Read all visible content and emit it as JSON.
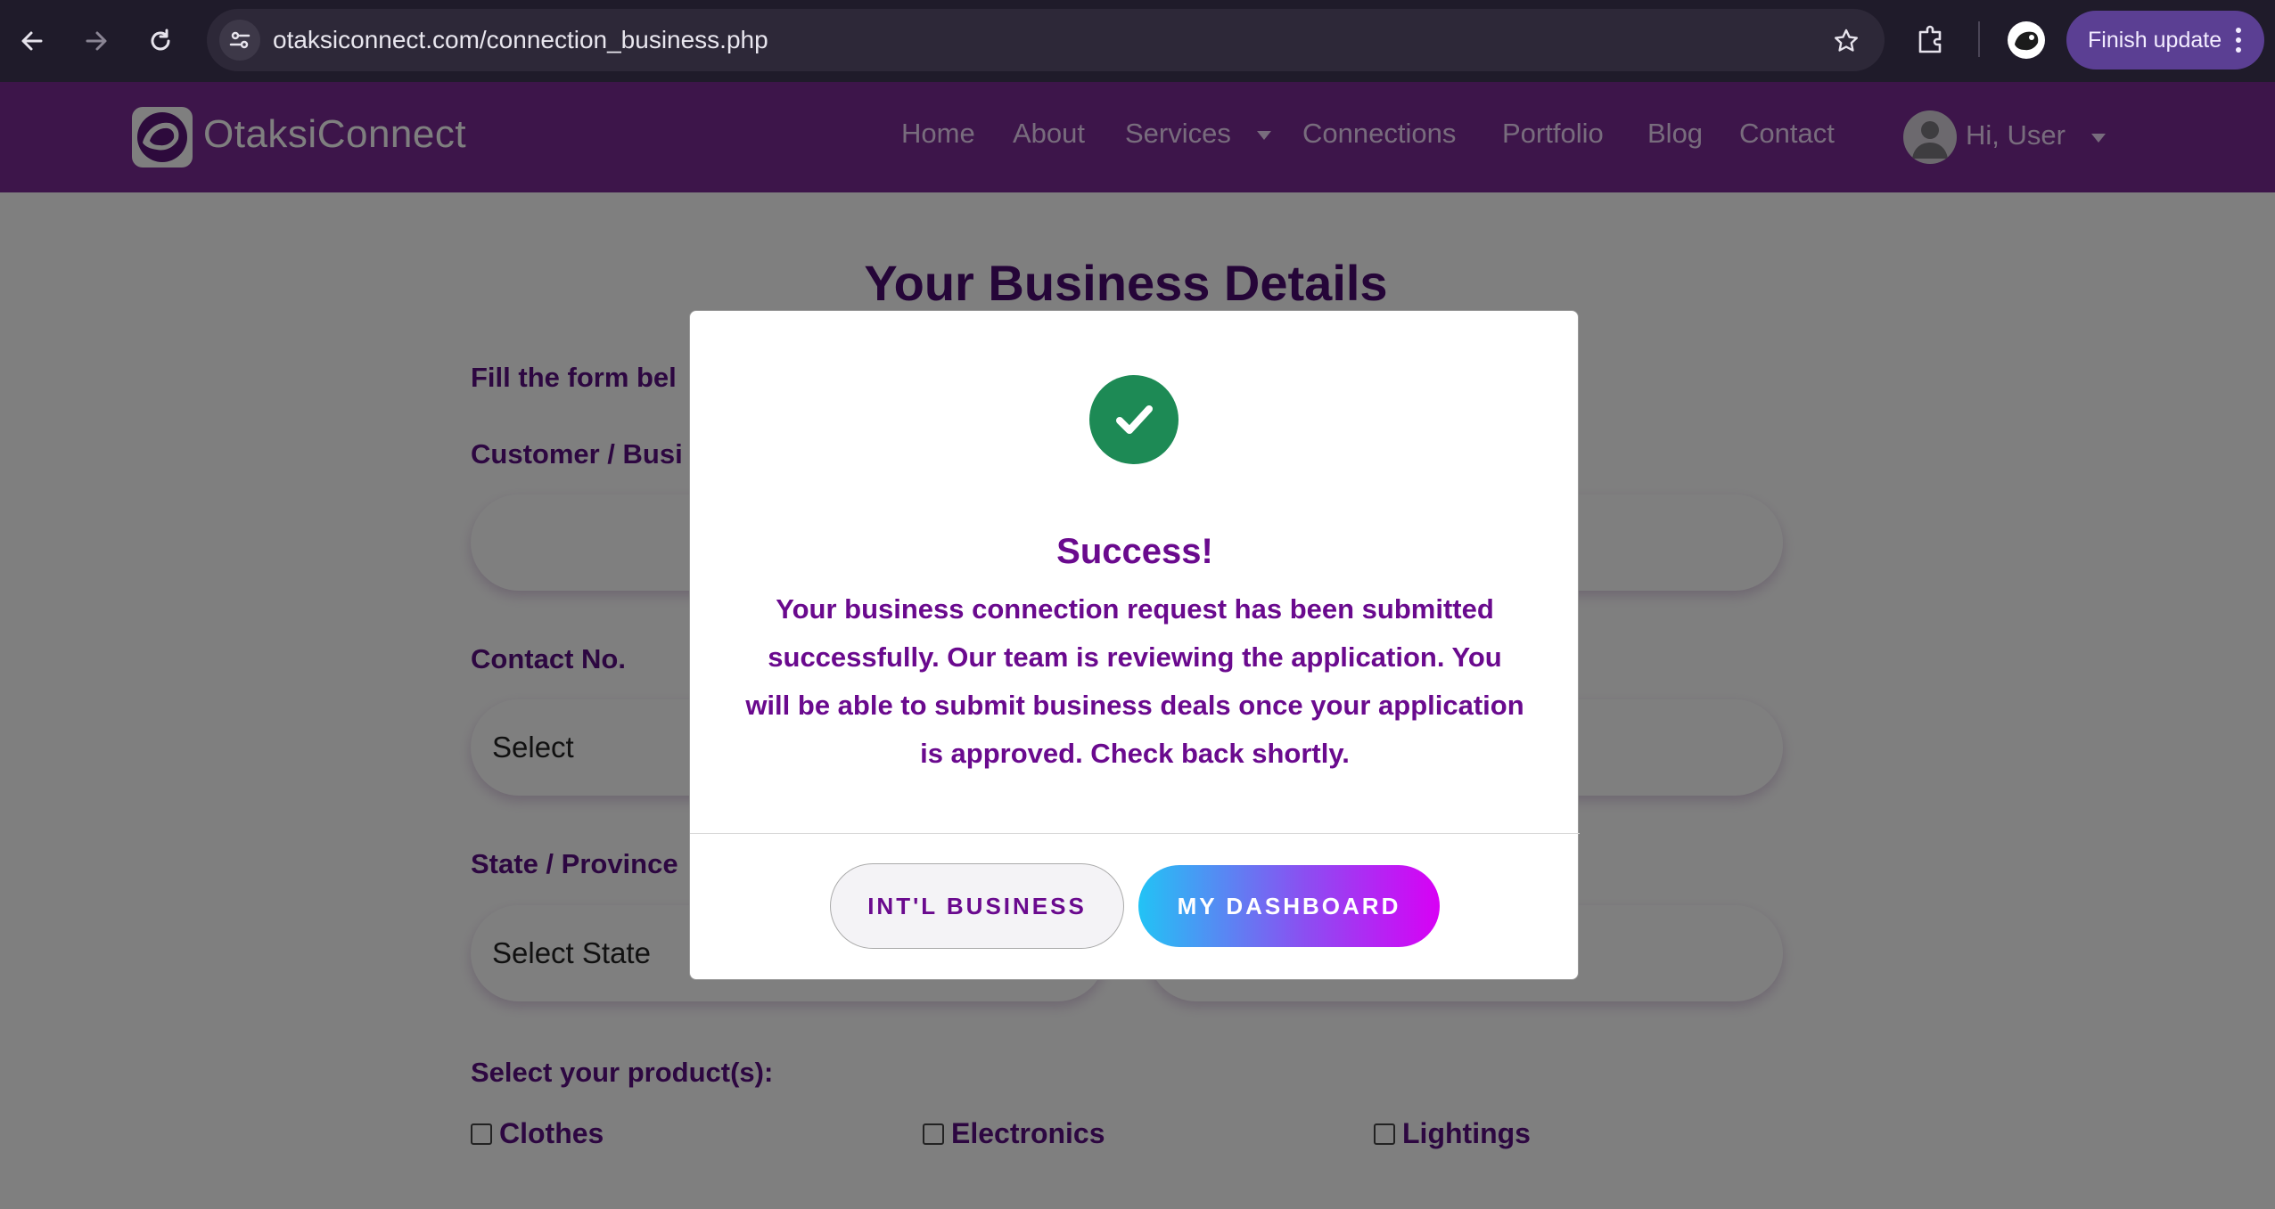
{
  "browser": {
    "url": "otaksiconnect.com/connection_business.php",
    "finish_update_label": "Finish update"
  },
  "site": {
    "brand": "OtaksiConnect",
    "nav": [
      "Home",
      "About",
      "Services",
      "Connections",
      "Portfolio",
      "Blog",
      "Contact"
    ],
    "user_greeting": "Hi, User"
  },
  "form": {
    "title": "Your Business Details",
    "intro": "Fill the form bel",
    "customer_label": "Customer / Busi",
    "contact_label": "Contact No.",
    "contact_select": "Select",
    "state_label": "State / Province",
    "state_select": "Select State",
    "products_label": "Select your product(s):",
    "products": [
      "Clothes",
      "Electronics",
      "Lightings"
    ]
  },
  "modal": {
    "title": "Success!",
    "message": "Your business connection request has been submitted successfully. Our team is reviewing the application. You will be able to submit business deals once your application is approved. Check back shortly.",
    "secondary_button": "INT'L BUSINESS",
    "primary_button": "MY DASHBOARD"
  },
  "colors": {
    "navbar": "#7a2b94",
    "modal_text": "#6a0a8e",
    "success": "#1d8a55"
  }
}
